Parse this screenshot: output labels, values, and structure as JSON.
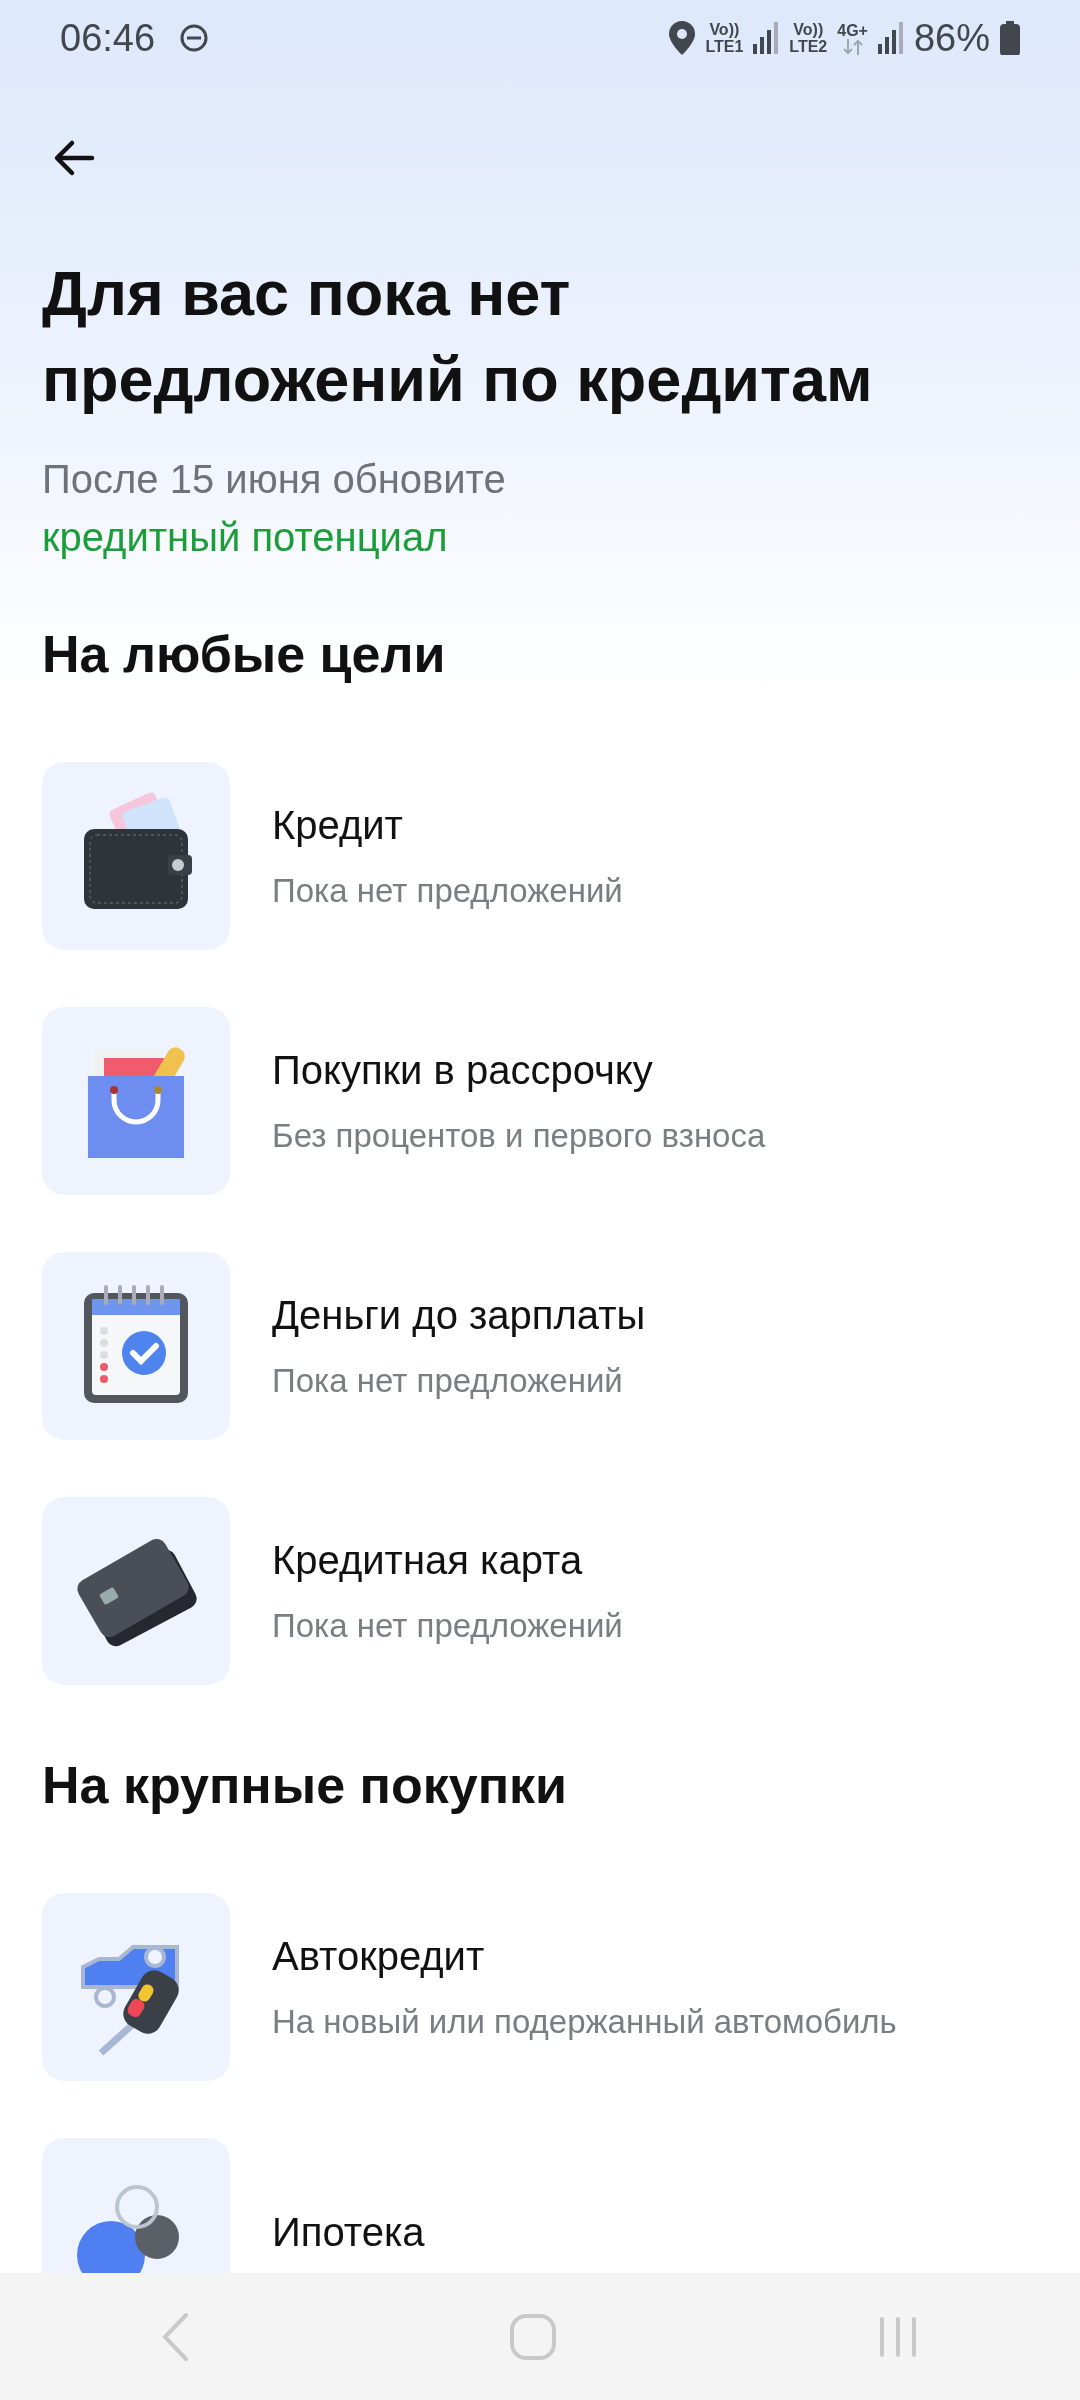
{
  "status_bar": {
    "time": "06:46",
    "sim1": {
      "top": "Vo))",
      "bottom": "LTE1"
    },
    "sim2": {
      "top": "Vo))",
      "bottom": "LTE2"
    },
    "network": "4G+",
    "battery": "86%"
  },
  "title": "Для вас пока нет предложений по кредитам",
  "subtitle": {
    "text": "После 15 июня обновите",
    "link": "кредитный потенциал"
  },
  "sections": [
    {
      "title": "На любые цели",
      "items": [
        {
          "title": "Кредит",
          "subtitle": "Пока нет предложений"
        },
        {
          "title": "Покупки в рассрочку",
          "subtitle": "Без процентов и первого взноса"
        },
        {
          "title": "Деньги до зарплаты",
          "subtitle": "Пока нет предложений"
        },
        {
          "title": "Кредитная карта",
          "subtitle": "Пока нет предложений"
        }
      ]
    },
    {
      "title": "На крупные покупки",
      "items": [
        {
          "title": "Автокредит",
          "subtitle": "На новый или подержанный автомобиль"
        },
        {
          "title": "Ипотека"
        }
      ]
    }
  ]
}
